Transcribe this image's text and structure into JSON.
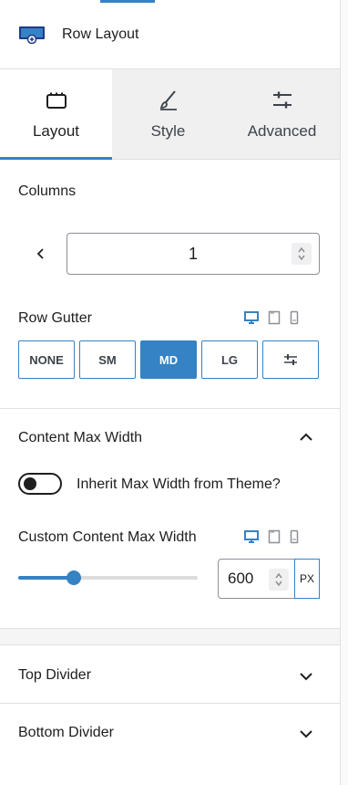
{
  "panel": {
    "title": "Row Layout"
  },
  "tabs": [
    {
      "label": "Layout",
      "icon": "layout-icon",
      "active": true
    },
    {
      "label": "Style",
      "icon": "brush-icon",
      "active": false
    },
    {
      "label": "Advanced",
      "icon": "sliders-icon",
      "active": false
    }
  ],
  "columns": {
    "label": "Columns",
    "value": "1"
  },
  "row_gutter": {
    "label": "Row Gutter",
    "options": [
      "NONE",
      "SM",
      "MD",
      "LG"
    ],
    "selected": "MD"
  },
  "content_max_width": {
    "section_title": "Content Max Width",
    "toggle_label": "Inherit Max Width from Theme?",
    "toggle_on": false,
    "custom_label": "Custom Content Max Width",
    "value": "600",
    "unit": "PX",
    "slider_fraction": 0.31
  },
  "sections": {
    "top_divider": "Top Divider",
    "bottom_divider": "Bottom Divider"
  },
  "colors": {
    "accent": "#3582c4"
  }
}
